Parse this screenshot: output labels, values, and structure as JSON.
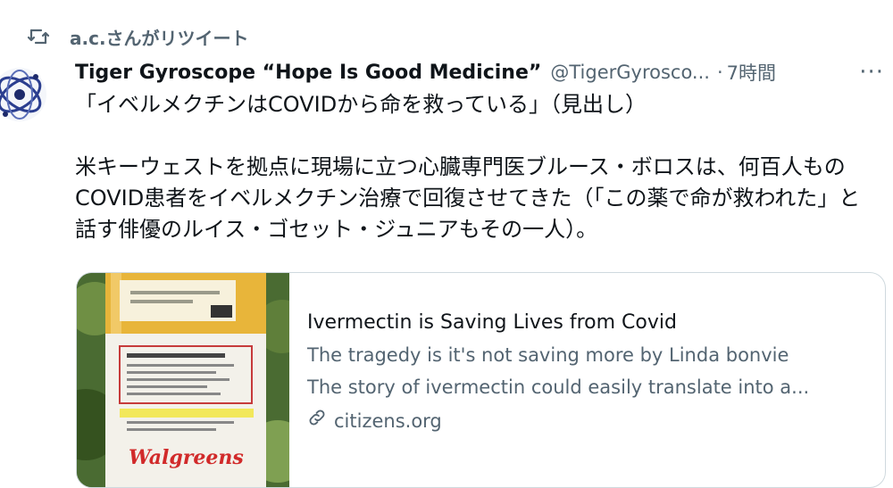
{
  "retweet": {
    "label": "a.c.さんがリツイート",
    "icon": "retweet-icon"
  },
  "author": {
    "display_name": "Tiger Gyroscope “Hope Is Good Medicine”",
    "handle": "@TigerGyrosco...",
    "separator": "·",
    "time": "7時間"
  },
  "more_label": "···",
  "tweet_text": "「イベルメクチンはCOVIDから命を救っている」（見出し）\n\n米キーウェストを拠点に現場に立つ心臓専門医ブルース・ボロスは、何百人ものCOVID患者をイベルメクチン治療で回復させてきた（「この薬で命が救われた」と話す俳優のルイス・ゴセット・ジュニアもその一人）。",
  "card": {
    "title": "Ivermectin is Saving Lives from Covid",
    "description_1": "The tragedy is it's not saving more by Linda bonvie",
    "description_2": "The story of ivermectin could easily translate into a...",
    "domain": "citizens.org",
    "image_label": "Walgreens"
  },
  "colors": {
    "text": "#0f1419",
    "secondary": "#536471",
    "border": "#cfd9de"
  }
}
